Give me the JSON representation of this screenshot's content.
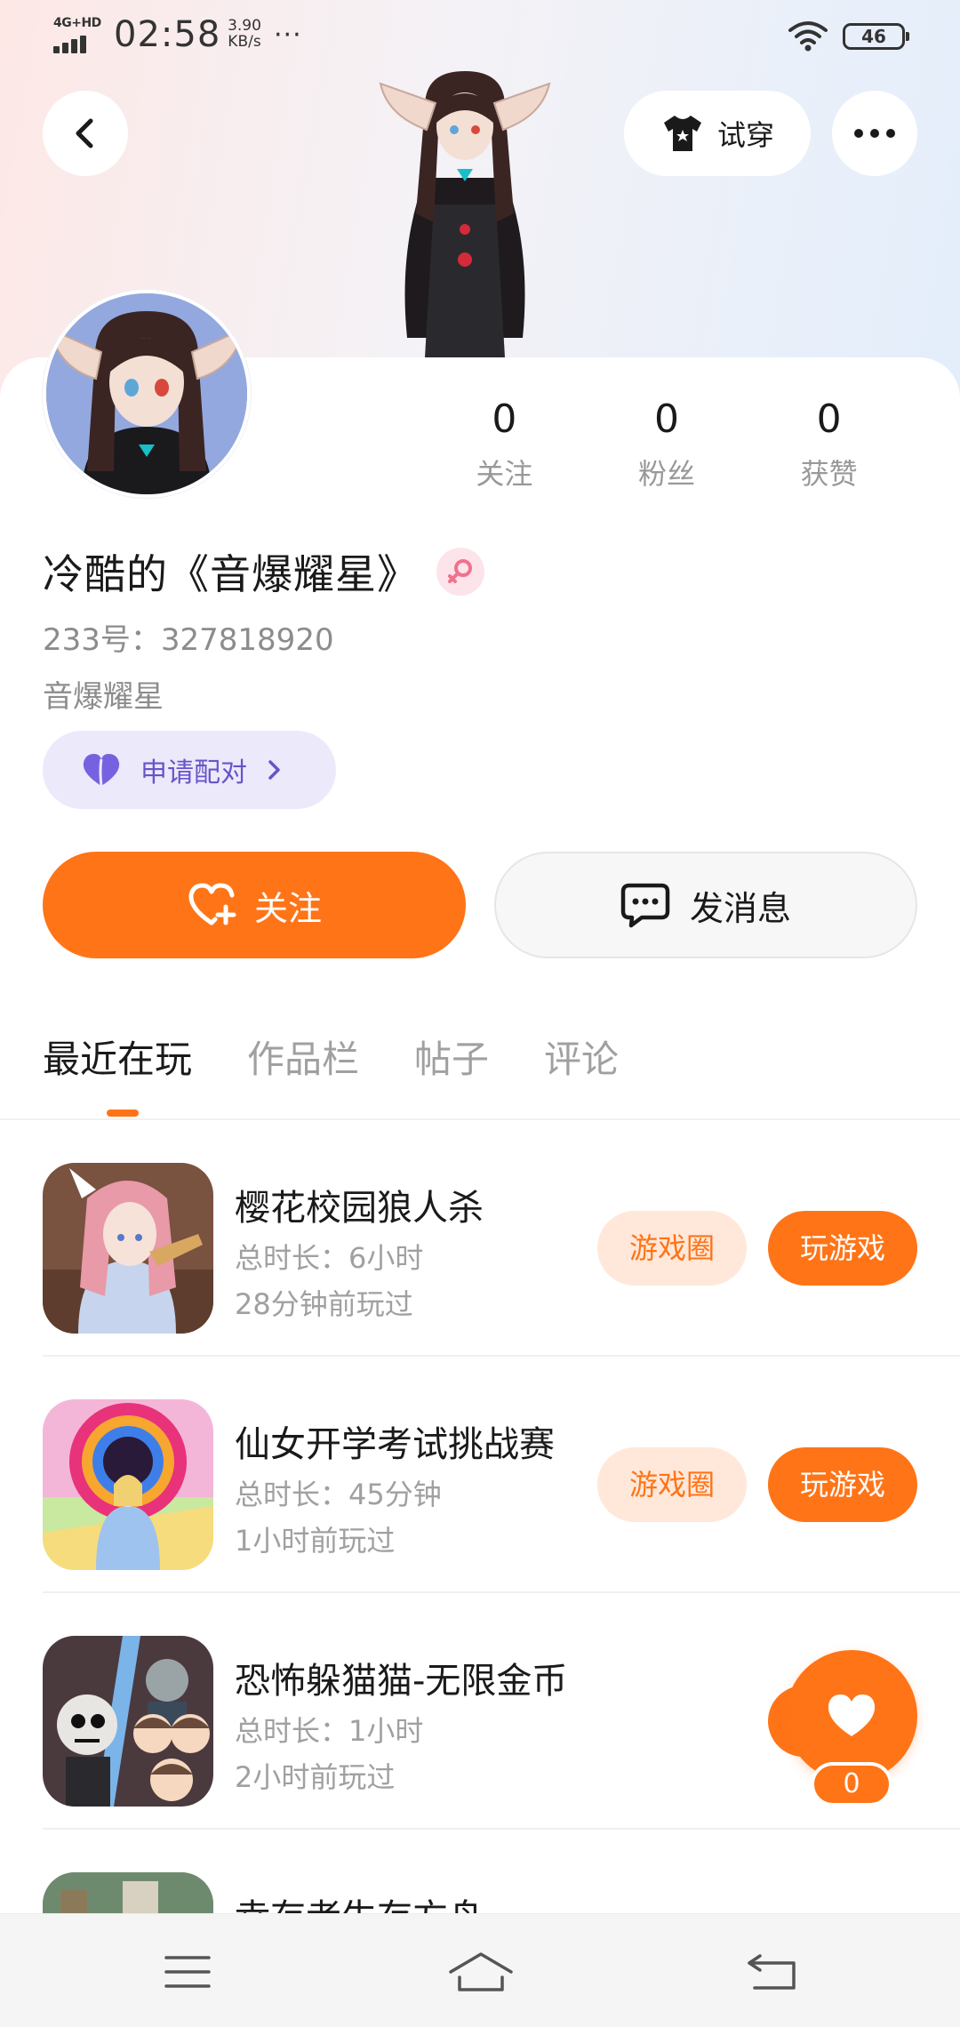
{
  "status_bar": {
    "network": "4G+HD",
    "time": "02:58",
    "speed_value": "3.90",
    "speed_unit": "KB/s",
    "more": "···",
    "battery": "46"
  },
  "header": {
    "tryon_label": "试穿"
  },
  "profile": {
    "name": "冷酷的《音爆耀星》",
    "id_label": "233号：327818920",
    "bio": "音爆耀星",
    "pair_label": "申请配对",
    "stats": [
      {
        "num": "0",
        "label": "关注"
      },
      {
        "num": "0",
        "label": "粉丝"
      },
      {
        "num": "0",
        "label": "获赞"
      }
    ]
  },
  "actions": {
    "follow_label": "关注",
    "message_label": "发消息"
  },
  "tabs": [
    "最近在玩",
    "作品栏",
    "帖子",
    "评论"
  ],
  "games": [
    {
      "title": "樱花校园狼人杀",
      "duration": "总时长：6小时",
      "last_played": "28分钟前玩过",
      "circle_label": "游戏圈",
      "play_label": "玩游戏"
    },
    {
      "title": "仙女开学考试挑战赛",
      "duration": "总时长：45分钟",
      "last_played": "1小时前玩过",
      "circle_label": "游戏圈",
      "play_label": "玩游戏"
    },
    {
      "title": "恐怖躲猫猫-无限金币",
      "duration": "总时长：1小时",
      "last_played": "2小时前玩过",
      "circle_label": "",
      "play_label": ""
    },
    {
      "title": "幸存者生存方舟",
      "duration": "",
      "last_played": "",
      "circle_label": "",
      "play_label": ""
    }
  ],
  "float_like": {
    "count": "0"
  },
  "colors": {
    "accent": "#ff7417",
    "accent_light": "#ffe8da",
    "pair_bg": "#ece9fb",
    "pair_text": "#6655c9"
  },
  "icons": [
    "back-icon",
    "tshirt-icon",
    "more-icon",
    "female-icon",
    "heart-icon",
    "chevron-right-icon",
    "heart-plus-icon",
    "chat-icon",
    "like-icon",
    "menu-icon",
    "home-icon",
    "return-icon"
  ]
}
